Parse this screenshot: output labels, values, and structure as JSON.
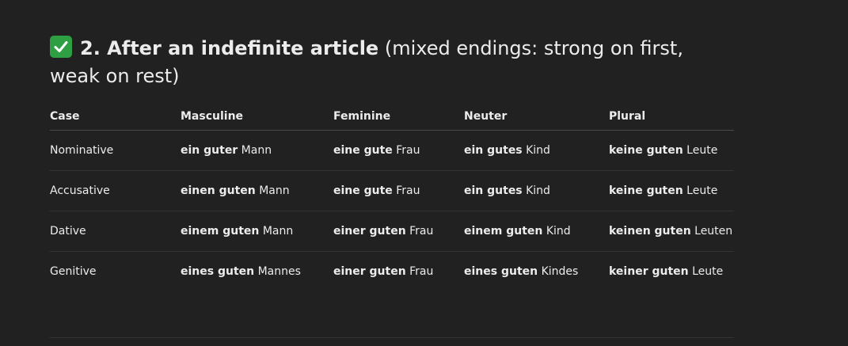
{
  "heading": {
    "icon": "check-mark-button-icon",
    "bold": "2. After an indefinite article",
    "rest": " (mixed endings: strong on first, weak on rest)"
  },
  "table": {
    "headers": [
      "Case",
      "Masculine",
      "Feminine",
      "Neuter",
      "Plural"
    ],
    "rows": [
      {
        "case": "Nominative",
        "cells": [
          {
            "bold": "ein guter",
            "noun": "Mann"
          },
          {
            "bold": "eine gute",
            "noun": "Frau"
          },
          {
            "bold": "ein gutes",
            "noun": "Kind"
          },
          {
            "bold": "keine guten",
            "noun": "Leute"
          }
        ]
      },
      {
        "case": "Accusative",
        "cells": [
          {
            "bold": "einen guten",
            "noun": "Mann"
          },
          {
            "bold": "eine gute",
            "noun": "Frau"
          },
          {
            "bold": "ein gutes",
            "noun": "Kind"
          },
          {
            "bold": "keine guten",
            "noun": "Leute"
          }
        ]
      },
      {
        "case": "Dative",
        "cells": [
          {
            "bold": "einem guten",
            "noun": "Mann"
          },
          {
            "bold": "einer guten",
            "noun": "Frau"
          },
          {
            "bold": "einem guten",
            "noun": "Kind"
          },
          {
            "bold": "keinen guten",
            "noun": "Leuten"
          }
        ]
      },
      {
        "case": "Genitive",
        "cells": [
          {
            "bold": "eines guten",
            "noun": "Mannes"
          },
          {
            "bold": "einer guten",
            "noun": "Frau"
          },
          {
            "bold": "eines guten",
            "noun": "Kindes"
          },
          {
            "bold": "keiner guten",
            "noun": "Leute"
          }
        ]
      }
    ]
  },
  "colors": {
    "background": "#212121",
    "text": "#ececec",
    "check_green": "#2ea043"
  }
}
